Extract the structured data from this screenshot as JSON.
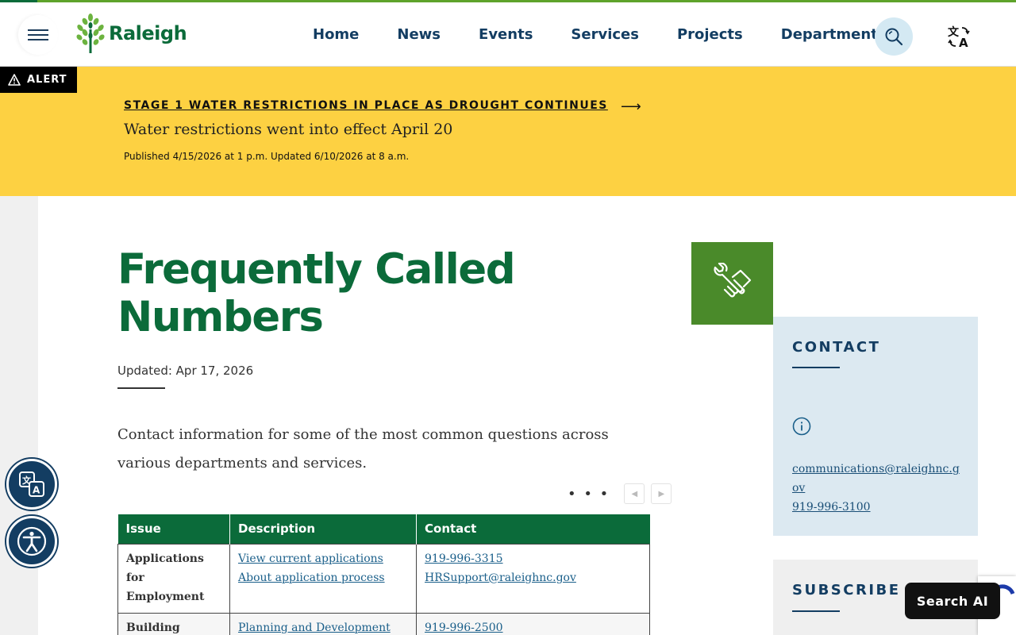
{
  "header": {
    "logo_text": "Raleigh",
    "nav": [
      "Home",
      "News",
      "Events",
      "Services",
      "Projects",
      "Departments"
    ]
  },
  "alert": {
    "tag": "ALERT",
    "headline": "STAGE 1 WATER RESTRICTIONS IN PLACE AS DROUGHT CONTINUES",
    "subtitle": "Water restrictions went into effect April 20",
    "meta": "Published 4/15/2026 at 1 p.m.  Updated 6/10/2026 at 8 a.m."
  },
  "page": {
    "title": "Frequently Called Numbers",
    "updated": "Updated: Apr 17, 2026",
    "intro": "Contact information for some of the most common questions across various departments and services."
  },
  "table": {
    "headers": [
      "Issue",
      "Description",
      "Contact"
    ],
    "rows": [
      {
        "issue": "Applications for Employment",
        "links": [
          "View current applications",
          "About application process"
        ],
        "contacts": [
          "919-996-3315",
          "HRSupport@raleighnc.gov"
        ]
      },
      {
        "issue": "Building",
        "links": [
          "Planning and Development"
        ],
        "contacts": [
          "919-996-2500"
        ]
      }
    ],
    "more_label": "• • •"
  },
  "sidebar": {
    "contact_heading": "CONTACT",
    "email": "communications@raleighnc.gov",
    "phone": "919-996-3100",
    "subscribe_heading": "SUBSCRIBE"
  },
  "widgets": {
    "search_ai_label": "Search AI"
  },
  "colors": {
    "brand_green": "#0b6b3a",
    "alert_yellow": "#fdd142",
    "navy": "#133d62",
    "contact_bg": "#dce9f1"
  }
}
